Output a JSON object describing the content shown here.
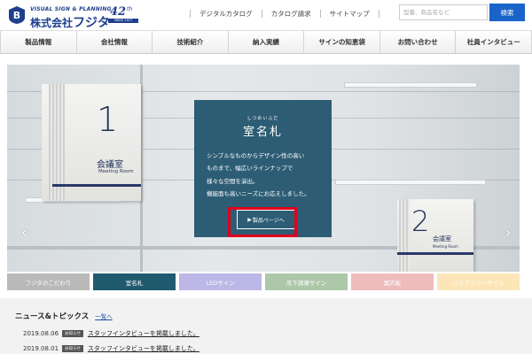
{
  "header": {
    "logo_tagline": "VISUAL SIGN & PLANNING",
    "logo_company": "株式会社",
    "logo_name": "フジタ",
    "anniversary_num": "42",
    "anniversary_suffix": "th",
    "anniversary_since": "SINCE 1977",
    "links": [
      {
        "label": "デジタルカタログ"
      },
      {
        "label": "カタログ請求"
      },
      {
        "label": "サイトマップ"
      }
    ],
    "search_placeholder": "型番、商品名など",
    "search_button": "検索"
  },
  "nav": {
    "items": [
      {
        "label": "製品情報"
      },
      {
        "label": "会社情報"
      },
      {
        "label": "技術紹介"
      },
      {
        "label": "納入実績"
      },
      {
        "label": "サインの知恵袋"
      },
      {
        "label": "お問い合わせ"
      },
      {
        "label": "社員インタビュー"
      }
    ]
  },
  "hero": {
    "sign1": {
      "number": "1",
      "ja": "会議室",
      "en": "Meeting Room"
    },
    "sign2": {
      "number": "2",
      "ja": "会議室",
      "en": "Meeting Room"
    },
    "panel": {
      "ruby": "しつめいふだ",
      "title": "室名札",
      "desc": [
        "シンプルなものからデザイン性の高い",
        "ものまで、幅広いラインナップで",
        "様々な空間を演出。",
        "機能面も高いニーズにお応えしました。"
      ],
      "button_label": "製品ページへ"
    },
    "arrow_left": "‹",
    "arrow_right": "›"
  },
  "categories": [
    {
      "label": "フジタのこだわり",
      "color": "#b9b9b9"
    },
    {
      "label": "室名札",
      "color": "#1f5a6e"
    },
    {
      "label": "LEDサイン",
      "color": "#bcb7e6"
    },
    {
      "label": "吊下誘導サイン",
      "color": "#acc8a8"
    },
    {
      "label": "案内板",
      "color": "#eebcbc"
    },
    {
      "label": "バリアフリーサイン",
      "color": "#fce6b8"
    }
  ],
  "news": {
    "title": "ニュース&トピックス",
    "more_link": "一覧へ",
    "items": [
      {
        "date": "2019.08.06",
        "badge": "お知らせ",
        "text": "スタッフインタビューを掲載しました。"
      },
      {
        "date": "2019.08.01",
        "badge": "お知らせ",
        "text": "スタッフインタビューを掲載しました。"
      }
    ]
  }
}
